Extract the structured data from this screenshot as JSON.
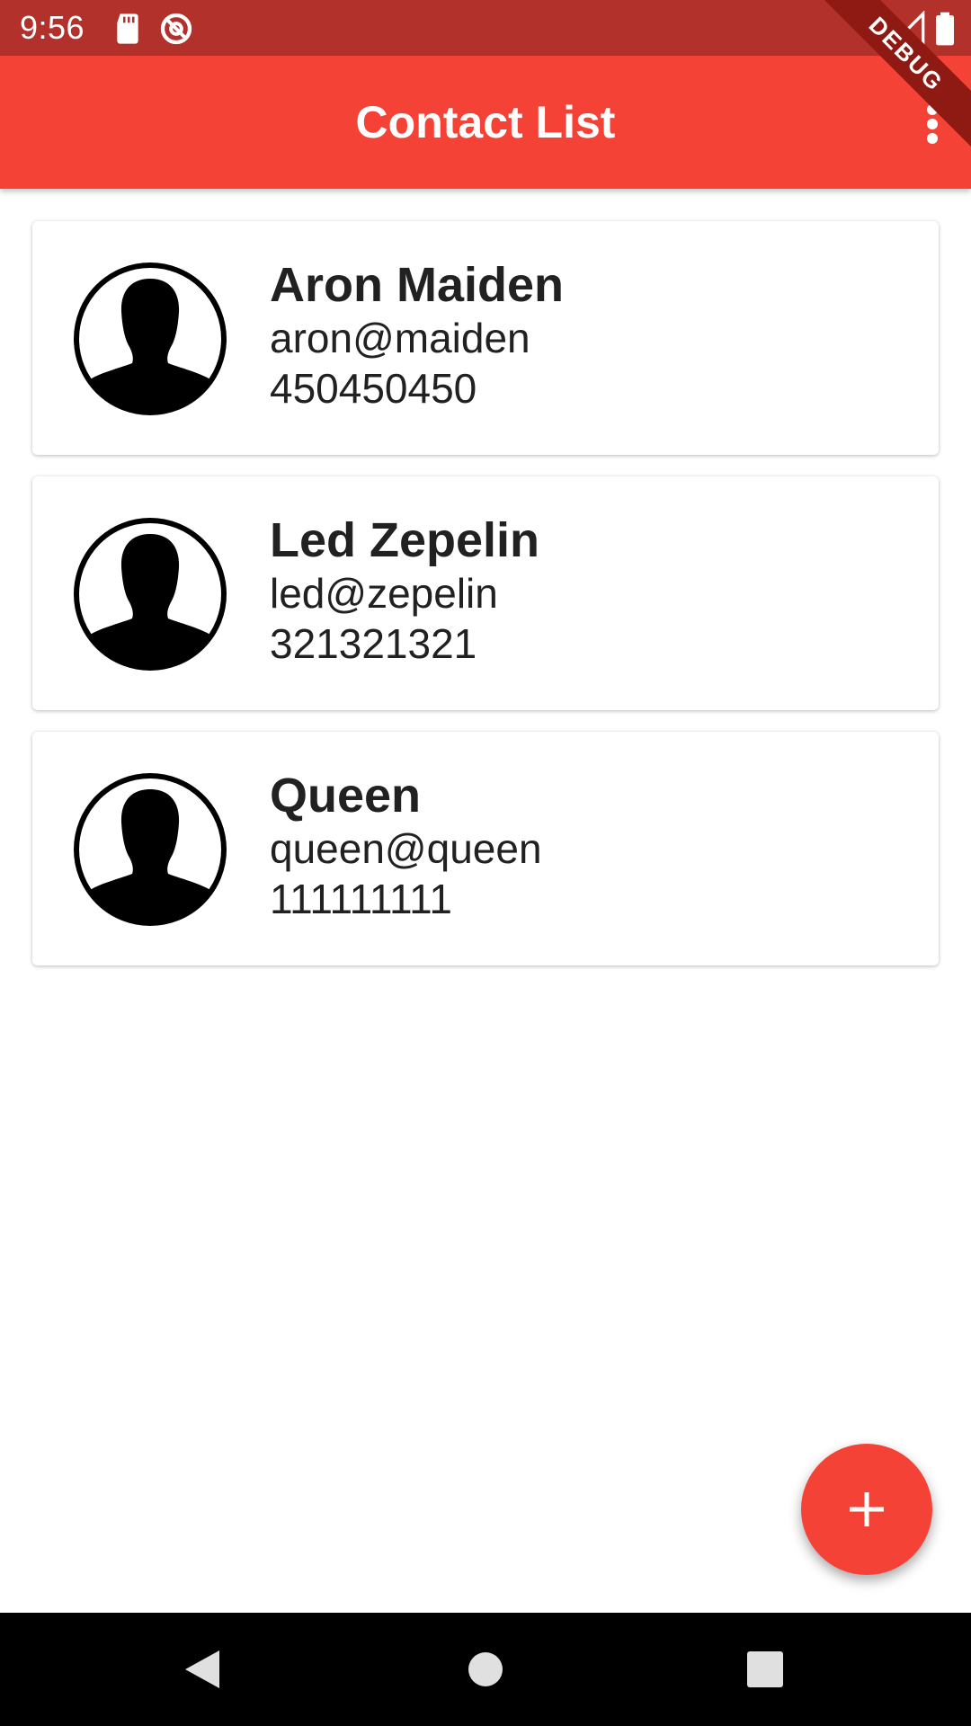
{
  "status_bar": {
    "time": "9:56",
    "icons": [
      "sd-card-icon",
      "sync-icon",
      "wifi-icon",
      "signal-icon",
      "battery-icon"
    ]
  },
  "debug_banner": "DEBUG",
  "app_bar": {
    "title": "Contact List",
    "menu_icon": "more-vert-icon",
    "color": "#f44336"
  },
  "contacts": [
    {
      "name": "Aron Maiden",
      "email": "aron@maiden",
      "phone": "450450450"
    },
    {
      "name": "Led Zepelin",
      "email": "led@zepelin",
      "phone": "321321321"
    },
    {
      "name": "Queen",
      "email": "queen@queen",
      "phone": "111111111"
    }
  ],
  "fab": {
    "icon": "add-icon",
    "color": "#f44336"
  },
  "nav_bar": {
    "icons": [
      "back-icon",
      "home-icon",
      "recents-icon"
    ]
  }
}
